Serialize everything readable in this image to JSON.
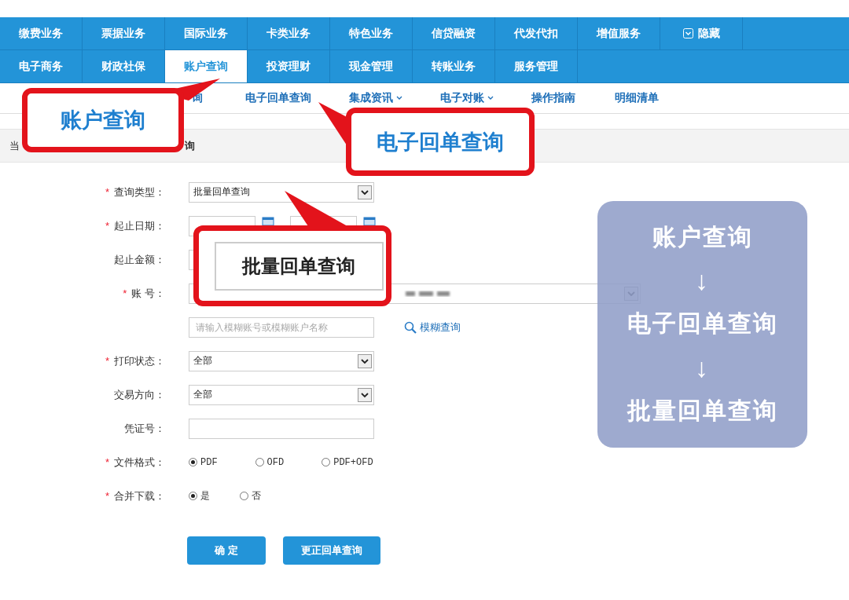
{
  "nav_rows": [
    [
      {
        "label": "缴费业务",
        "selected": false
      },
      {
        "label": "票据业务",
        "selected": false
      },
      {
        "label": "国际业务",
        "selected": false
      },
      {
        "label": "卡类业务",
        "selected": false
      },
      {
        "label": "特色业务",
        "selected": false
      },
      {
        "label": "信贷融资",
        "selected": false
      },
      {
        "label": "代发代扣",
        "selected": false
      },
      {
        "label": "增值服务",
        "selected": false
      }
    ],
    [
      {
        "label": "电子商务",
        "selected": false
      },
      {
        "label": "财政社保",
        "selected": false
      },
      {
        "label": "账户查询",
        "selected": true
      },
      {
        "label": "投资理财",
        "selected": false
      },
      {
        "label": "现金管理",
        "selected": false
      },
      {
        "label": "转账业务",
        "selected": false
      },
      {
        "label": "服务管理",
        "selected": false
      }
    ]
  ],
  "hide_toggle": {
    "label": "隐藏"
  },
  "sub_menu": [
    {
      "label": "询",
      "dropdown": false
    },
    {
      "label": "电子回单查询",
      "dropdown": false
    },
    {
      "label": "集成资讯",
      "dropdown": true
    },
    {
      "label": "电子对账",
      "dropdown": true
    },
    {
      "label": "操作指南",
      "dropdown": false
    },
    {
      "label": "明细清单",
      "dropdown": false
    }
  ],
  "breadcrumb": {
    "start": "当",
    "end": "询"
  },
  "form": [
    {
      "kind": "select",
      "marker": "*",
      "label": "查询类型：",
      "value": "批量回单查询"
    },
    {
      "kind": "date_range",
      "marker": "*",
      "label": "起止日期："
    },
    {
      "kind": "amount_range",
      "label": "起止金额："
    },
    {
      "kind": "account",
      "marker": "*",
      "label": "账 号："
    },
    {
      "kind": "search",
      "placeholder": "请输入模糊账号或模糊账户名称",
      "link": "模糊查询"
    },
    {
      "kind": "select",
      "marker": "*",
      "label": "打印状态：",
      "value": "全部"
    },
    {
      "kind": "select",
      "label": "交易方向：",
      "value": "全部"
    },
    {
      "kind": "text",
      "label": "凭证号："
    },
    {
      "kind": "radio",
      "marker": "*",
      "label": "文件格式：",
      "options": [
        {
          "label": "PDF",
          "selected": true
        },
        {
          "label": "OFD",
          "selected": false
        },
        {
          "label": "PDF+OFD",
          "selected": false
        }
      ]
    },
    {
      "kind": "radio",
      "marker": "*",
      "label": "合并下载：",
      "options": [
        {
          "label": "是",
          "selected": true
        },
        {
          "label": "否",
          "selected": false
        }
      ]
    }
  ],
  "buttons": [
    "确 定",
    "更正回单查询"
  ],
  "callouts": [
    {
      "kind": "tab",
      "text": "账户查询"
    },
    {
      "kind": "menu",
      "text": "电子回单查询"
    },
    {
      "kind": "field",
      "text": "批量回单查询"
    }
  ],
  "flow_panel": [
    {
      "kind": "step",
      "text": "账户查询"
    },
    {
      "kind": "arrow",
      "text": "↓"
    },
    {
      "kind": "step",
      "text": "电子回单查询"
    },
    {
      "kind": "arrow",
      "text": "↓"
    },
    {
      "kind": "step",
      "text": "批量回单查询"
    }
  ]
}
